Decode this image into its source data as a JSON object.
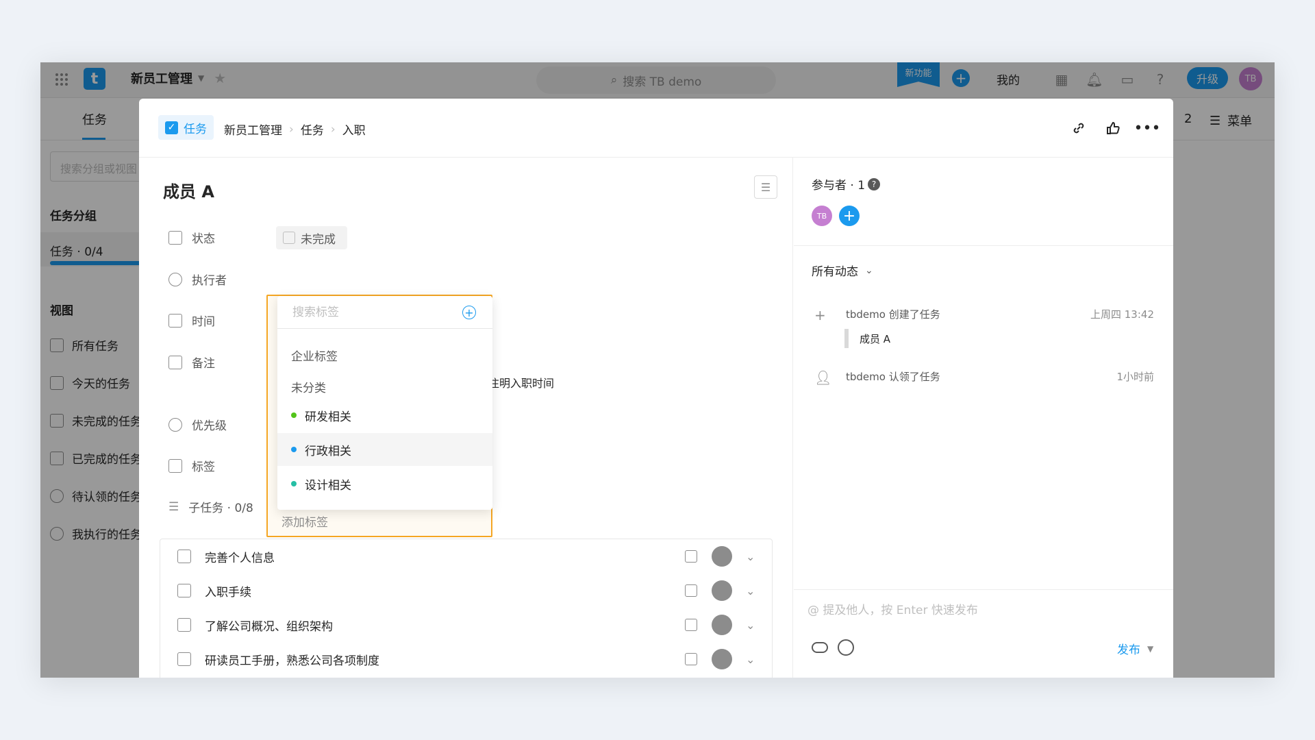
{
  "topbar": {
    "logo": "t",
    "project_name": "新员工管理",
    "search_placeholder": "搜索 TB demo",
    "new_feature_badge": "新功能",
    "mine_label": "我的",
    "upgrade_label": "升级",
    "avatar_initials": "TB"
  },
  "subnav": {
    "tab_tasks": "任务",
    "members_count": "2",
    "menu_label": "菜单"
  },
  "sidebar": {
    "search_placeholder": "搜索分组或视图",
    "group_heading": "任务分组",
    "group_item": "任务 · 0/4",
    "views_heading": "视图",
    "views": [
      "所有任务",
      "今天的任务",
      "未完成的任务",
      "已完成的任务",
      "待认领的任务",
      "我执行的任务"
    ]
  },
  "modal": {
    "type_label": "任务",
    "breadcrumb": [
      "新员工管理",
      "任务",
      "入职"
    ],
    "title": "成员 A",
    "fields": {
      "status": "状态",
      "status_value": "未完成",
      "assignee": "执行者",
      "time": "时间",
      "note": "备注",
      "note_text": "注明入职时间",
      "priority": "优先级",
      "tags": "标签",
      "tags_add": "添加标签"
    },
    "subtasks_header": "子任务 · 0/8",
    "subtasks": [
      "完善个人信息",
      "入职手续",
      "了解公司概况、组织架构",
      "研读员工手册，熟悉公司各项制度"
    ]
  },
  "tag_dropdown": {
    "search_placeholder": "搜索标签",
    "group_enterprise": "企业标签",
    "group_uncategorized": "未分类",
    "options": [
      {
        "label": "研发相关",
        "color": "#52c41a"
      },
      {
        "label": "行政相关",
        "color": "#1b9aee"
      },
      {
        "label": "设计相关",
        "color": "#26bfa5"
      }
    ]
  },
  "right_pane": {
    "participants_label": "参与者 · 1",
    "participant_initials": "TB",
    "activity_filter": "所有动态",
    "activities": [
      {
        "text": "tbdemo 创建了任务",
        "time": "上周四 13:42",
        "quote": "成员 A"
      },
      {
        "text": "tbdemo 认领了任务",
        "time": "1小时前"
      }
    ],
    "comment_placeholder": "@ 提及他人，按 Enter 快速发布",
    "publish_label": "发布"
  },
  "colors": {
    "accent": "#1b9aee",
    "highlight_border": "#f5a623"
  }
}
